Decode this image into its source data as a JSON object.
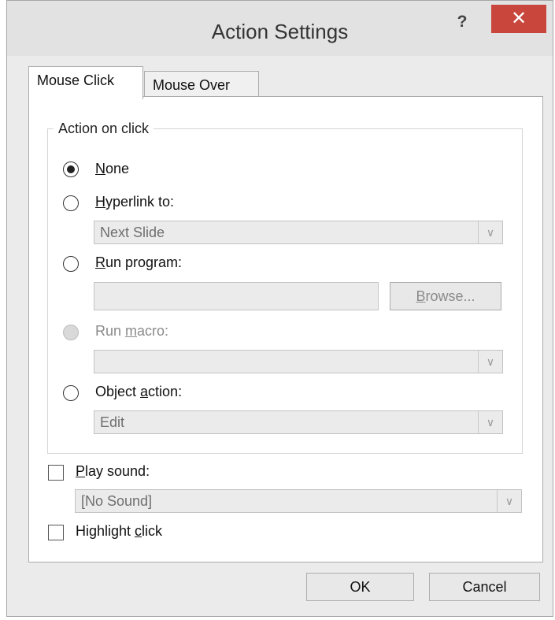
{
  "title": "Action Settings",
  "title_help": "?",
  "title_close": "✕",
  "tabs": [
    {
      "label": "Mouse Click"
    },
    {
      "label": "Mouse Over"
    }
  ],
  "group_label": "Action on click",
  "none": {
    "u": "N",
    "rest": "one"
  },
  "hyperlink": {
    "u": "H",
    "rest": "yperlink to:",
    "value": "Next Slide"
  },
  "run_program": {
    "u": "R",
    "rest": "un program:",
    "value": ""
  },
  "browse": {
    "u": "B",
    "rest": "rowse..."
  },
  "run_macro": {
    "pre": "Run ",
    "u": "m",
    "rest": "acro:",
    "value": ""
  },
  "object_action": {
    "pre": "Object ",
    "u": "a",
    "rest": "ction:",
    "value": "Edit"
  },
  "play_sound": {
    "u": "P",
    "rest": "lay sound:",
    "value": "[No Sound]"
  },
  "highlight": {
    "pre": "Highlight ",
    "u": "c",
    "rest": "lick"
  },
  "combo_arrow": "∨",
  "ok_label": "OK",
  "cancel_label": "Cancel"
}
